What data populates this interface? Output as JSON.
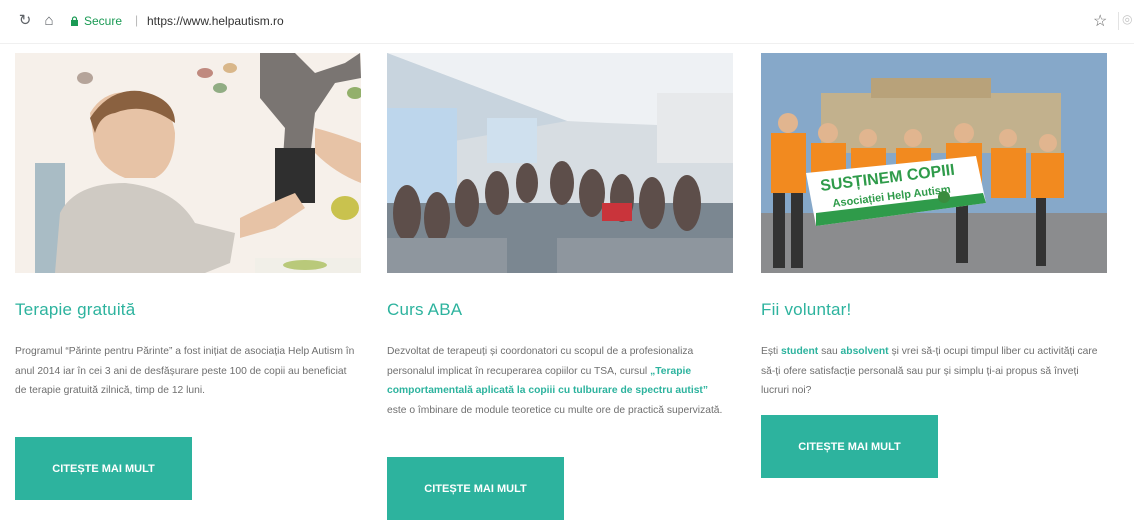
{
  "browser": {
    "secure_label": "Secure",
    "url": "https://www.helpautism.ro",
    "icons": [
      "reload-icon",
      "home-icon",
      "lock-icon",
      "star-icon",
      "extension-icon"
    ]
  },
  "cards": [
    {
      "title": "Terapie gratuită",
      "text": "Programul “Părinte pentru Părinte” a fost inițiat de asociația Help Autism în anul 2014 iar în cei 3 ani de desfășurare peste 100 de copii au beneficiat de terapie gratuită zilnică, timp de 12 luni.",
      "button": "Citește mai mult"
    },
    {
      "title": "Curs ABA",
      "text_1": "Dezvoltat de terapeuți și coordonatori cu scopul de a profesionaliza personalul implicat în recuperarea copiilor cu TSA, cursul ",
      "text_bold": "„Terapie comportamentală aplicată la copiii cu tulburare de spectru autist”",
      "text_2": " este o îmbinare de module teoretice cu multe ore de practică supervizată.",
      "button": "Citește mai mult"
    },
    {
      "title": "Fii voluntar!",
      "text_1": "Ești ",
      "text_bold_1": "student",
      "text_2": " sau ",
      "text_bold_2": "absolvent",
      "text_3": " și vrei să-ți ocupi timpul liber cu activități care să-ți ofere satisfacție personală sau pur și simplu ți-ai propus să înveți lucruri noi?",
      "banner_line_1": "SUSȚINEM COPIII",
      "banner_line_2": "Asociației Help Autism",
      "button": "Citește mai mult"
    }
  ],
  "colors": {
    "accent": "#2db39e",
    "body_text": "#6f6f6f",
    "secure": "#1a9a54"
  }
}
